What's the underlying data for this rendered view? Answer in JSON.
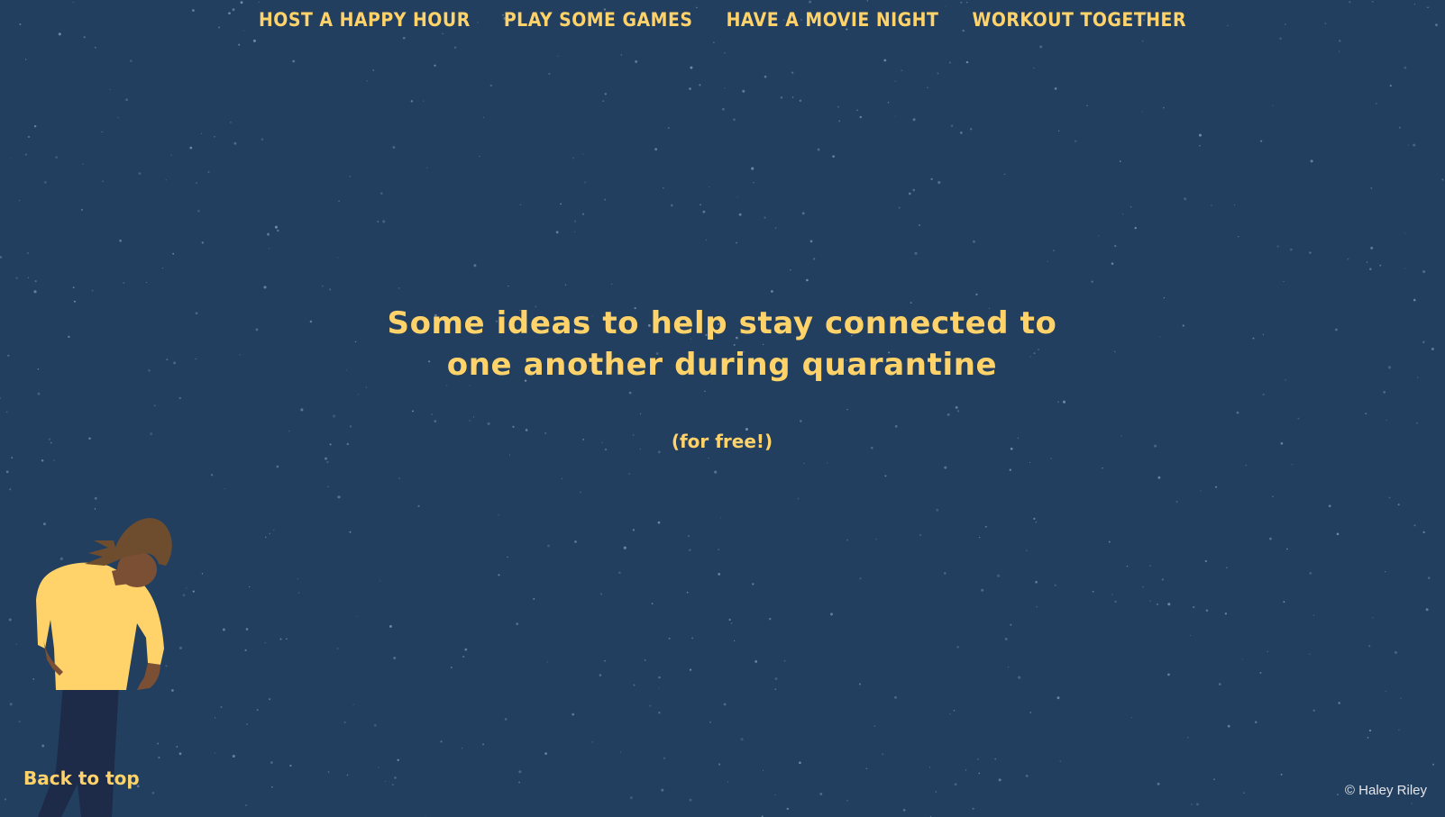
{
  "nav": {
    "links": [
      {
        "label": "HOST A HAPPY HOUR"
      },
      {
        "label": "PLAY SOME GAMES"
      },
      {
        "label": "HAVE A MOVIE NIGHT"
      },
      {
        "label": "WORKOUT TOGETHER"
      }
    ]
  },
  "hero": {
    "headline": "Some ideas to help stay connected to one another during quarantine",
    "subheadline": "(for free!)"
  },
  "footer": {
    "back_to_top": "Back to top",
    "copyright": "© Haley Riley"
  },
  "illustration": {
    "icon": "person-illustration"
  },
  "colors": {
    "background": "#233f5f",
    "accent": "#ffd36a",
    "shirt": "#ffd36a",
    "pants": "#1d2a48",
    "skin": "#7a4f34",
    "hair": "#6e4d2f"
  }
}
